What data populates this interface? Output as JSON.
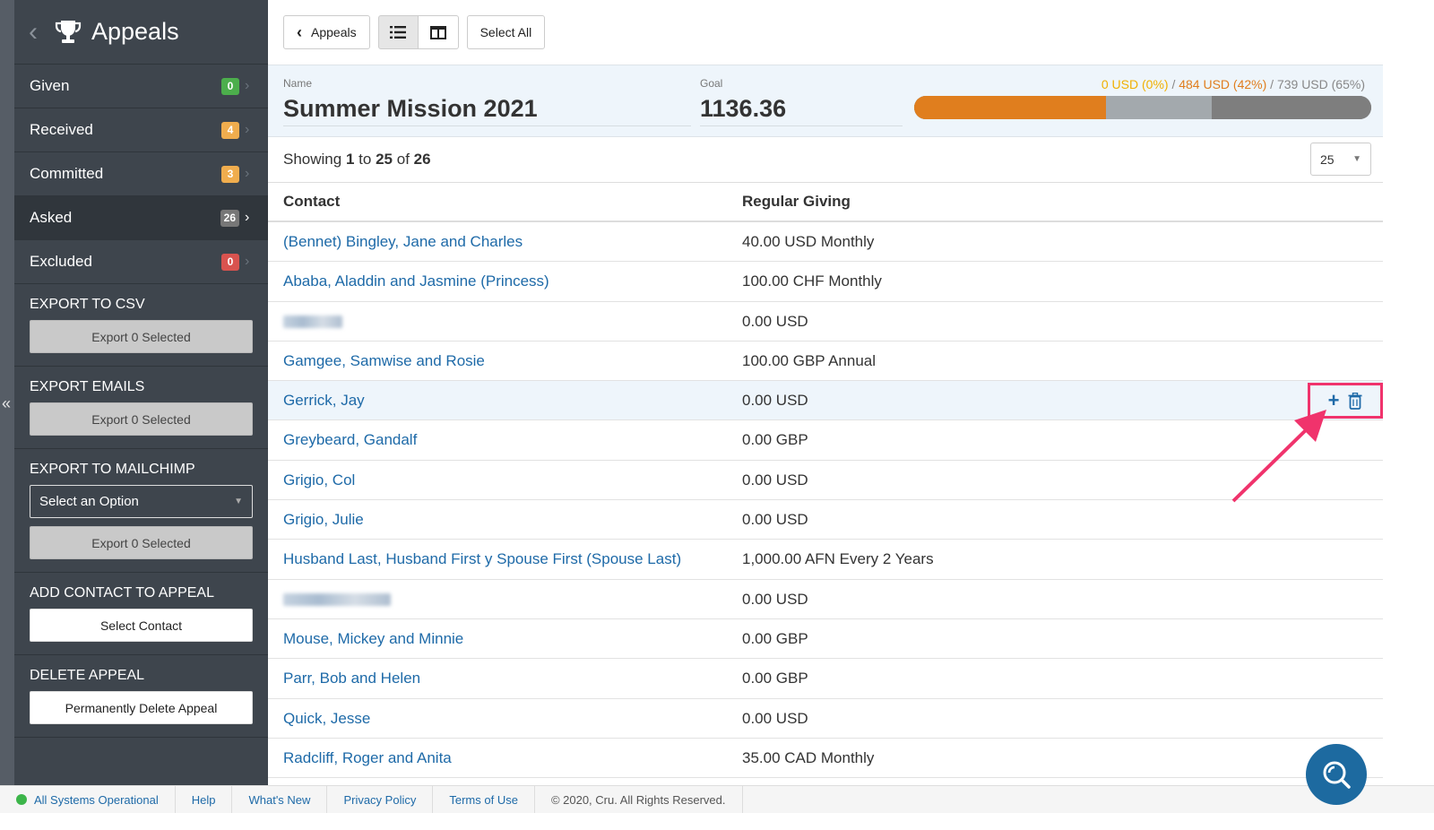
{
  "sidebar": {
    "title": "Appeals",
    "items": [
      {
        "label": "Given",
        "count": "0",
        "color": "#4cae4c"
      },
      {
        "label": "Received",
        "count": "4",
        "color": "#f0ad4e"
      },
      {
        "label": "Committed",
        "count": "3",
        "color": "#f0ad4e"
      },
      {
        "label": "Asked",
        "count": "26",
        "color": "#777777"
      },
      {
        "label": "Excluded",
        "count": "0",
        "color": "#d9534f"
      }
    ],
    "export_csv": {
      "title": "EXPORT TO CSV",
      "button": "Export 0 Selected"
    },
    "export_emails": {
      "title": "EXPORT EMAILS",
      "button": "Export 0 Selected"
    },
    "export_mailchimp": {
      "title": "EXPORT TO MAILCHIMP",
      "select": "Select an Option",
      "button": "Export 0 Selected"
    },
    "add_contact": {
      "title": "ADD CONTACT TO APPEAL",
      "button": "Select Contact"
    },
    "delete_appeal": {
      "title": "DELETE APPEAL",
      "button": "Permanently Delete Appeal"
    }
  },
  "toolbar": {
    "back_label": "Appeals",
    "select_all": "Select All"
  },
  "appeal": {
    "name_label": "Name",
    "name": "Summer Mission 2021",
    "goal_label": "Goal",
    "goal": "1136.36",
    "legend": {
      "given": "0 USD (0%)",
      "received": "484 USD (42%)",
      "committed": "739 USD (65%)"
    },
    "progress": {
      "given": 0.42,
      "received": 0.65,
      "committed": 1.0
    },
    "colors": {
      "given": "#e07e1e",
      "received": "#a3a9ad",
      "committed": "#7e7e7e"
    }
  },
  "showing": {
    "prefix": "Showing",
    "from": "1",
    "to_word": "to",
    "to": "25",
    "of_word": "of",
    "total": "26"
  },
  "per_page": "25",
  "table": {
    "headers": {
      "contact": "Contact",
      "giving": "Regular Giving"
    },
    "rows": [
      {
        "contact": "(Bennet) Bingley, Jane and Charles",
        "giving": "40.00 USD Monthly"
      },
      {
        "contact": "Ababa, Aladdin and Jasmine (Princess)",
        "giving": "100.00 CHF Monthly"
      },
      {
        "contact": "",
        "giving": "0.00 USD",
        "blur": 66
      },
      {
        "contact": "Gamgee, Samwise and Rosie",
        "giving": "100.00 GBP Annual"
      },
      {
        "contact": "Gerrick, Jay",
        "giving": "0.00 USD",
        "hover": true
      },
      {
        "contact": "Greybeard, Gandalf",
        "giving": "0.00 GBP"
      },
      {
        "contact": "Grigio, Col",
        "giving": "0.00 USD"
      },
      {
        "contact": "Grigio, Julie",
        "giving": "0.00 USD"
      },
      {
        "contact": "Husband Last, Husband First y Spouse First (Spouse Last)",
        "giving": "1,000.00 AFN Every 2 Years"
      },
      {
        "contact": "",
        "giving": "0.00 USD",
        "blur": 120
      },
      {
        "contact": "Mouse, Mickey and Minnie",
        "giving": "0.00 GBP"
      },
      {
        "contact": "Parr, Bob and Helen",
        "giving": "0.00 GBP"
      },
      {
        "contact": "Quick, Jesse",
        "giving": "0.00 USD"
      },
      {
        "contact": "Radcliff, Roger and Anita",
        "giving": "35.00 CAD Monthly"
      }
    ]
  },
  "footer": {
    "status": "All Systems Operational",
    "links": [
      "Help",
      "What's New",
      "Privacy Policy",
      "Terms of Use"
    ],
    "copyright": "© 2020, Cru. All Rights Reserved."
  }
}
